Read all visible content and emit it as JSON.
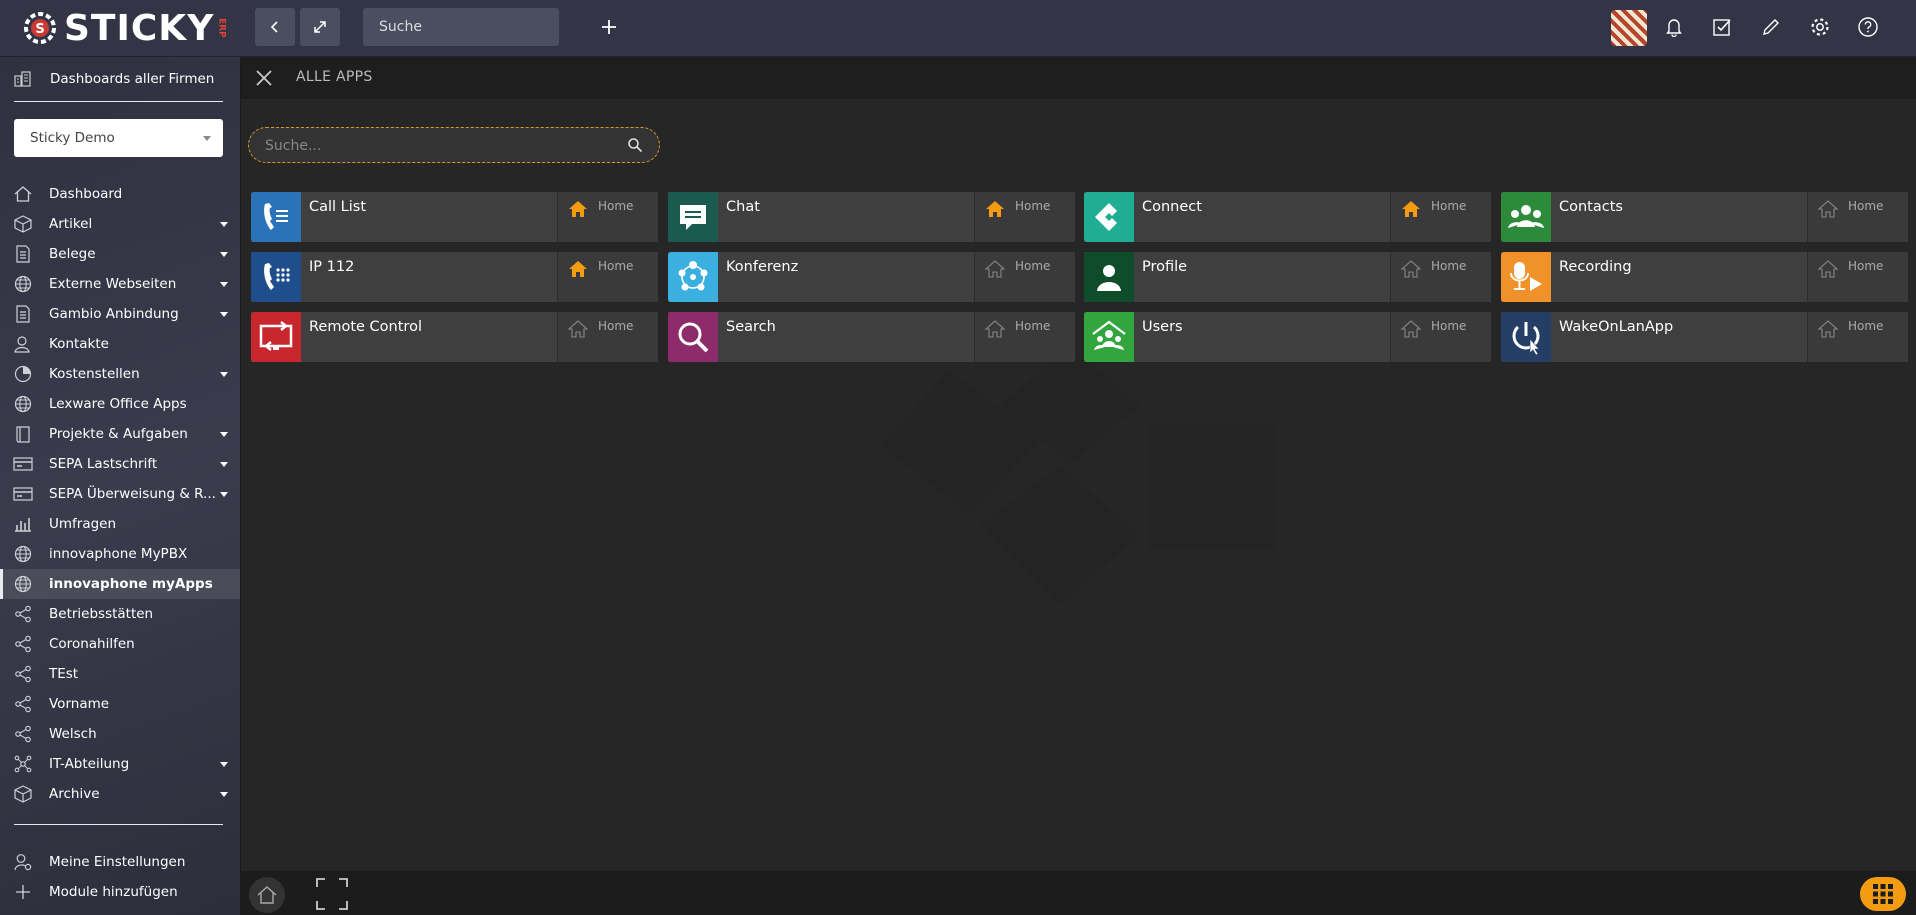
{
  "topbar": {
    "logo_text": "STICKY",
    "logo_tag": "ERP",
    "search_label": "Suche",
    "icons": [
      "chevron-left-icon",
      "expand-icon",
      "plus-icon",
      "bell-icon",
      "checkbox-icon",
      "pencil-icon",
      "gear-icon",
      "help-icon"
    ]
  },
  "sidebar": {
    "dashboards_all": "Dashboards aller Firmen",
    "company": "Sticky Demo",
    "items": [
      {
        "label": "Dashboard",
        "icon": "home-icon",
        "arrow": false
      },
      {
        "label": "Artikel",
        "icon": "box-icon",
        "arrow": true
      },
      {
        "label": "Belege",
        "icon": "document-icon",
        "arrow": true
      },
      {
        "label": "Externe Webseiten",
        "icon": "globe-icon",
        "arrow": true
      },
      {
        "label": "Gambio Anbindung",
        "icon": "document-icon",
        "arrow": true
      },
      {
        "label": "Kontakte",
        "icon": "person-icon",
        "arrow": false
      },
      {
        "label": "Kostenstellen",
        "icon": "pie-icon",
        "arrow": true
      },
      {
        "label": "Lexware Office Apps",
        "icon": "globe-icon",
        "arrow": false
      },
      {
        "label": "Projekte & Aufgaben",
        "icon": "book-icon",
        "arrow": true
      },
      {
        "label": "SEPA Lastschrift",
        "icon": "card-icon",
        "arrow": true
      },
      {
        "label": "SEPA Überweisung & R...",
        "icon": "card-icon",
        "arrow": true
      },
      {
        "label": "Umfragen",
        "icon": "bar-chart-icon",
        "arrow": false
      },
      {
        "label": "innovaphone MyPBX",
        "icon": "globe-icon",
        "arrow": false
      },
      {
        "label": "innovaphone myApps",
        "icon": "globe-icon",
        "arrow": false,
        "active": true
      },
      {
        "label": "Betriebsstätten",
        "icon": "share-icon",
        "arrow": false
      },
      {
        "label": "Coronahilfen",
        "icon": "share-icon",
        "arrow": false
      },
      {
        "label": "TEst",
        "icon": "share-icon",
        "arrow": false
      },
      {
        "label": "Vorname",
        "icon": "share-icon",
        "arrow": false
      },
      {
        "label": "Welsch",
        "icon": "share-icon",
        "arrow": false
      },
      {
        "label": "IT-Abteilung",
        "icon": "network-icon",
        "arrow": true
      },
      {
        "label": "Archive",
        "icon": "box-icon",
        "arrow": true
      }
    ],
    "bottom_items": [
      {
        "label": "Meine Einstellungen",
        "icon": "person-settings-icon"
      },
      {
        "label": "Module hinzufügen",
        "icon": "plus-icon"
      }
    ]
  },
  "main": {
    "title": "ALLE APPS",
    "search_placeholder": "Suche...",
    "home_label": "Home",
    "apps": [
      {
        "name": "Call List",
        "color": "#2a73b8",
        "home_active": true,
        "icon": "call-list-icon"
      },
      {
        "name": "Chat",
        "color": "#1a5a4f",
        "home_active": true,
        "icon": "chat-icon"
      },
      {
        "name": "Connect",
        "color": "#1fae94",
        "home_active": true,
        "icon": "connect-icon"
      },
      {
        "name": "Contacts",
        "color": "#2e8a3b",
        "home_active": false,
        "icon": "contacts-icon"
      },
      {
        "name": "IP 112",
        "color": "#1e4f8c",
        "home_active": true,
        "icon": "phone-keypad-icon"
      },
      {
        "name": "Konferenz",
        "color": "#3bb0e0",
        "home_active": false,
        "icon": "conference-icon"
      },
      {
        "name": "Profile",
        "color": "#0f4d2a",
        "home_active": false,
        "icon": "profile-icon"
      },
      {
        "name": "Recording",
        "color": "#f0912a",
        "home_active": false,
        "icon": "recording-icon"
      },
      {
        "name": "Remote Control",
        "color": "#c8282d",
        "home_active": false,
        "icon": "remote-control-icon"
      },
      {
        "name": "Search",
        "color": "#8e2c6b",
        "home_active": false,
        "icon": "magnifier-icon"
      },
      {
        "name": "Users",
        "color": "#33a53f",
        "home_active": false,
        "icon": "users-icon"
      },
      {
        "name": "WakeOnLanApp",
        "color": "#243e66",
        "home_active": false,
        "icon": "power-icon"
      }
    ]
  },
  "colors": {
    "accent": "#f39c12",
    "home_active": "#f39c12",
    "home_inactive": "#888888"
  }
}
